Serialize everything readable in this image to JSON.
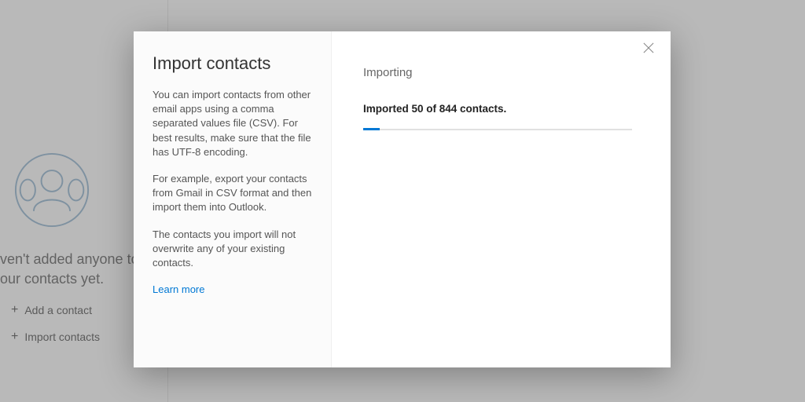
{
  "background": {
    "empty_line1": "ven't added anyone to",
    "empty_line2": "our contacts yet.",
    "actions": {
      "add_contact": "Add a contact",
      "import_contacts": "Import contacts"
    }
  },
  "dialog": {
    "title": "Import contacts",
    "para1": "You can import contacts from other email apps using a comma separated values file (CSV). For best results, make sure that the file has UTF-8 encoding.",
    "para2": "For example, export your contacts from Gmail in CSV format and then import them into Outlook.",
    "para3": "The contacts you import will not overwrite any of your existing contacts.",
    "learn_more": "Learn more",
    "right": {
      "heading": "Importing",
      "progress_text": "Imported 50 of 844 contacts.",
      "progress_percent": 6
    }
  }
}
